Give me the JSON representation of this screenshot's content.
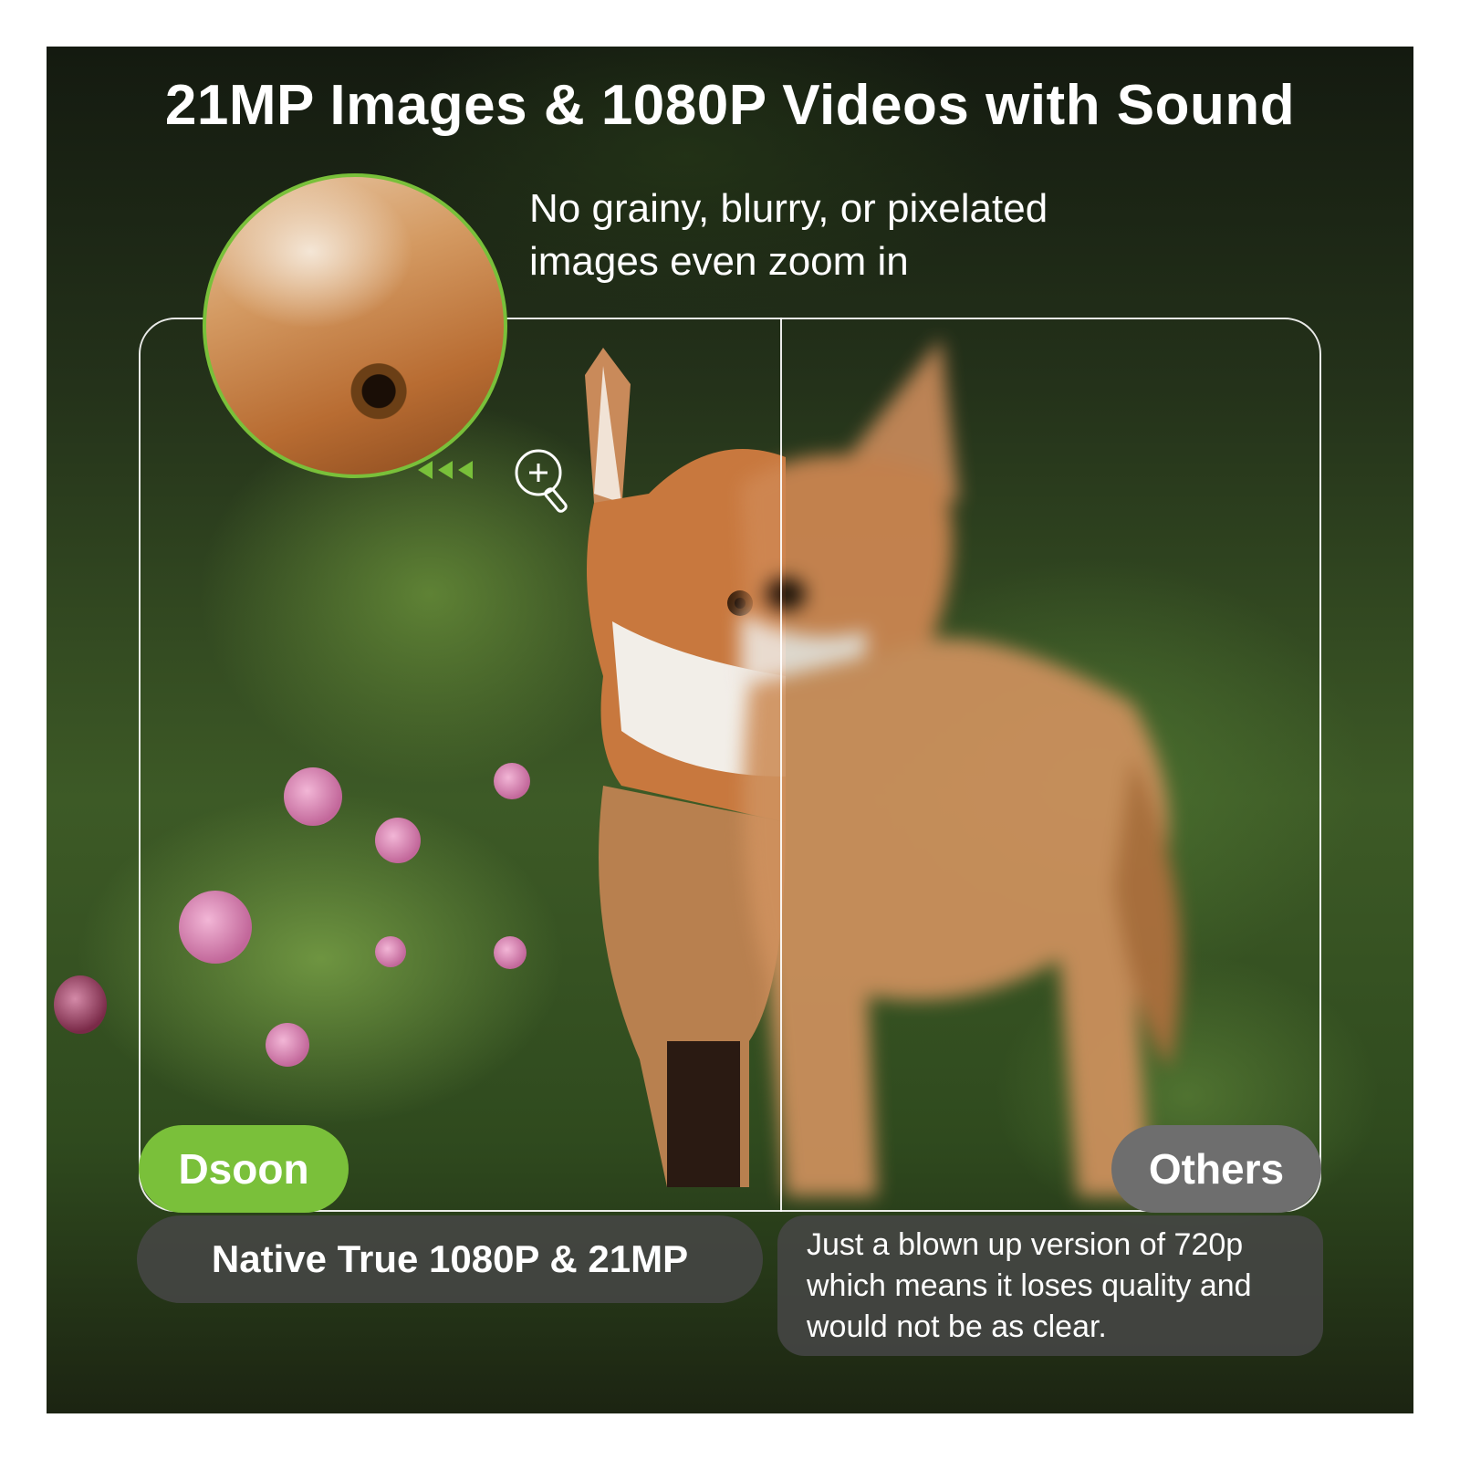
{
  "headline": "21MP Images & 1080P Videos with Sound",
  "subtitle": {
    "line1": "No grainy, blurry, or pixelated",
    "line2": "images even zoom in"
  },
  "labels": {
    "left_brand": "Dsoon",
    "right_brand": "Others"
  },
  "captions": {
    "left": "Native True 1080P & 21MP",
    "right_line1": "Just a blown up version of 720p",
    "right_line2": "which means it loses quality and",
    "right_line3": "would not be as clear."
  },
  "colors": {
    "accent_green": "#7ac03a",
    "others_gray": "#6e6e6e"
  },
  "icons": [
    "zoom-in-icon",
    "left-arrows-icon"
  ]
}
